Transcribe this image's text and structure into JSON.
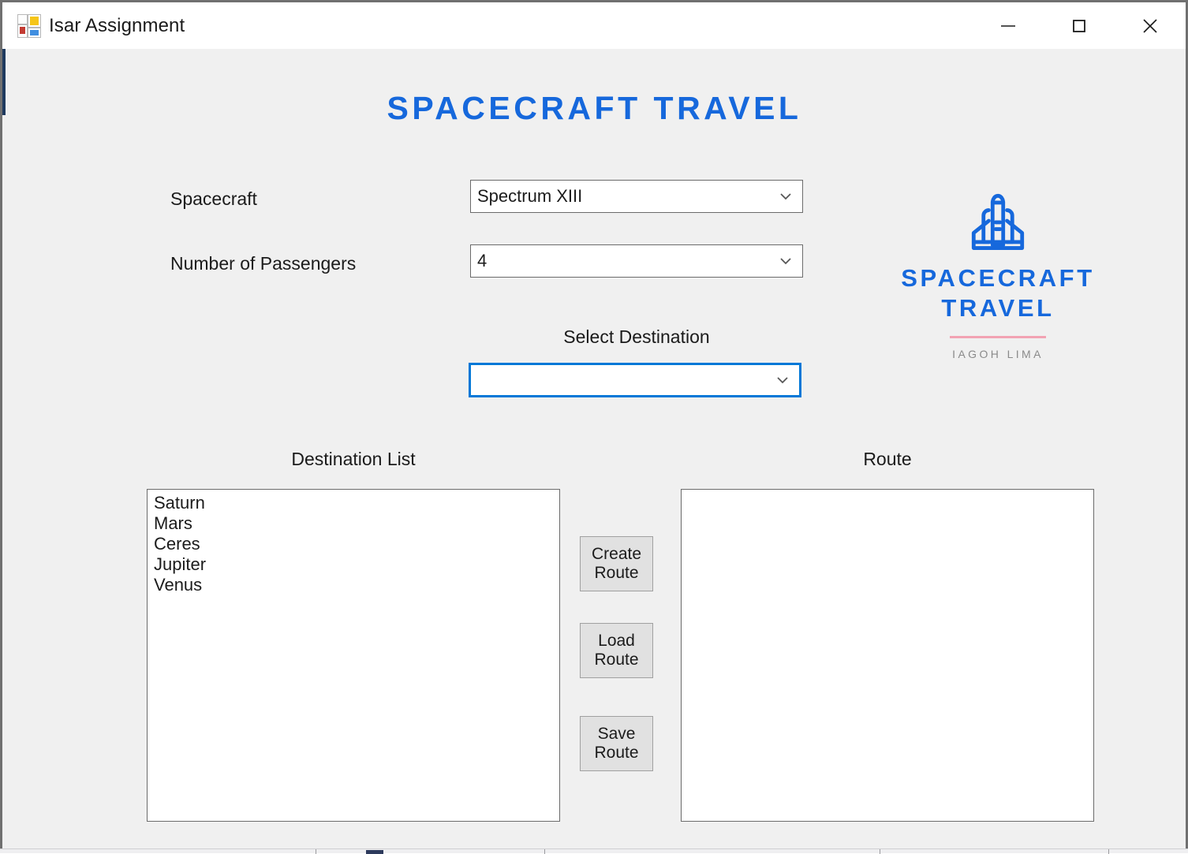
{
  "window": {
    "title": "Isar Assignment",
    "icon": "winforms-app-icon",
    "controls": [
      {
        "name": "minimize",
        "glyph": "minimize-icon"
      },
      {
        "name": "maximize",
        "glyph": "maximize-icon"
      },
      {
        "name": "close",
        "glyph": "close-icon"
      }
    ]
  },
  "heading": {
    "text": "SPACECRAFT TRAVEL",
    "color": "#1668dc"
  },
  "form": {
    "spacecraft": {
      "label": "Spacecraft",
      "value": "Spectrum XIII",
      "placeholder": ""
    },
    "passengers": {
      "label": "Number of Passengers",
      "value": "4",
      "placeholder": ""
    },
    "destination": {
      "label": "Select Destination",
      "value": "",
      "placeholder": "",
      "focus_border_color": "#0078d7"
    }
  },
  "logo": {
    "icon": "space-shuttle-icon",
    "title_line1": "SPACECRAFT",
    "title_line2": "TRAVEL",
    "subtitle": "IAGOH LIMA",
    "brand_color": "#1668dc",
    "divider_color": "#f2a3b3"
  },
  "lists": {
    "destination": {
      "caption": "Destination List",
      "items": [
        "Saturn",
        "Mars",
        "Ceres",
        "Jupiter",
        "Venus"
      ]
    },
    "route": {
      "caption": "Route",
      "items": []
    }
  },
  "buttons": {
    "create_route": {
      "line1": "Create",
      "line2": "Route"
    },
    "load_route": {
      "line1": "Load",
      "line2": "Route"
    },
    "save_route": {
      "line1": "Save",
      "line2": "Route"
    }
  }
}
